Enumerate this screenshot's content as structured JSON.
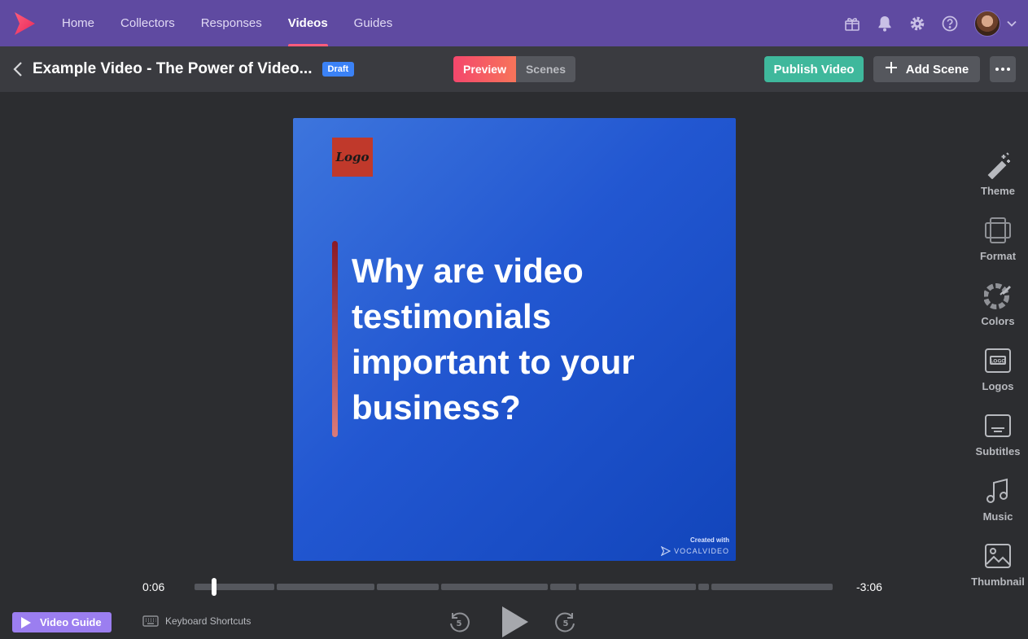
{
  "nav": {
    "links": [
      "Home",
      "Collectors",
      "Responses",
      "Videos",
      "Guides"
    ],
    "active": "Videos"
  },
  "header": {
    "title": "Example Video - The Power of Video...",
    "badge": "Draft",
    "tabs": {
      "preview": "Preview",
      "scenes": "Scenes"
    },
    "publish_label": "Publish Video",
    "add_scene_label": "Add Scene"
  },
  "scene": {
    "logo_text": "Logo",
    "headline": "Why are video testimonials important to your business?",
    "watermark_created": "Created with",
    "watermark_brand": "VOCALVIDEO"
  },
  "tools": [
    "Theme",
    "Format",
    "Colors",
    "Logos",
    "Subtitles",
    "Music",
    "Thumbnail"
  ],
  "player": {
    "current_time": "0:06",
    "remaining_time": "-3:06",
    "skip_seconds": "5"
  },
  "footer": {
    "guide_label": "Video Guide",
    "shortcuts_label": "Keyboard Shortcuts"
  },
  "colors": {
    "nav_bg": "#5f4aa1",
    "accent_pink": "#f4476c",
    "publish_green": "#3fb89c",
    "draft_blue": "#3b82f6",
    "guide_purple": "#9b7ef0"
  }
}
